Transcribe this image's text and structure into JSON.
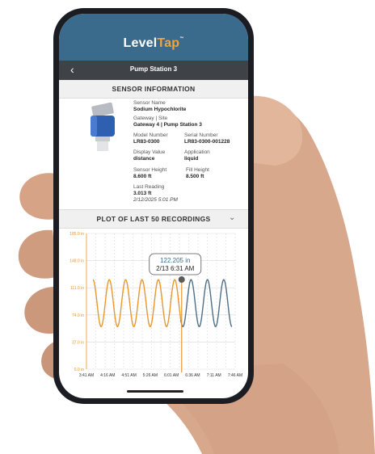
{
  "app": {
    "brand_main": "Level",
    "brand_accent": "Tap",
    "brand_tm": "™"
  },
  "nav": {
    "back_icon": "chevron-left-icon",
    "title": "Pump Station 3"
  },
  "sensor_info": {
    "header": "SENSOR INFORMATION",
    "name_label": "Sensor Name",
    "name_value": "Sodium Hypochlorite",
    "gateway_label": "Gateway | Site",
    "gateway_value": "Gateway 4 | Pump Station 3",
    "model_label": "Model Number",
    "model_value": "LR83-0300",
    "serial_label": "Serial Number",
    "serial_value": "LR83-0300-001228",
    "display_label": "Display Value",
    "display_value": "distance",
    "application_label": "Application",
    "application_value": "liquid",
    "sensor_height_label": "Sensor Height",
    "sensor_height_value": "8.600 ft",
    "fill_height_label": "Fill Height",
    "fill_height_value": "8.500 ft",
    "last_reading_label": "Last Reading",
    "last_reading_value": "3.013 ft",
    "last_reading_time": "2/12/2025 5:01 PM"
  },
  "plot": {
    "header": "PLOT OF LAST 50 RECORDINGS",
    "collapse_icon": "chevron-down-icon"
  },
  "chart_data": {
    "type": "line",
    "title": "",
    "xlabel": "",
    "ylabel": "",
    "y_ticks": [
      "0.0 in",
      "37.0 in",
      "74.0 in",
      "111.0 in",
      "148.0 in",
      "185.0 in"
    ],
    "y_tick_values": [
      0,
      37,
      74,
      111,
      148,
      185
    ],
    "x_ticks": [
      "3:41 AM",
      "4:16 AM",
      "4:51 AM",
      "5:26 AM",
      "6:01 AM",
      "6:36 AM",
      "7:11 AM",
      "7:46 AM"
    ],
    "ylim": [
      0,
      185
    ],
    "grid": true,
    "series_colors": {
      "highlighted": "#e8962e",
      "rest": "#4f6f86"
    },
    "wave": {
      "min": 58,
      "max": 122,
      "cycles": 8.5
    },
    "tooltip": {
      "value": "122.205 in",
      "time": "2/13 6:31 AM",
      "at_x_fraction": 0.64,
      "y_value": 122.205
    }
  }
}
